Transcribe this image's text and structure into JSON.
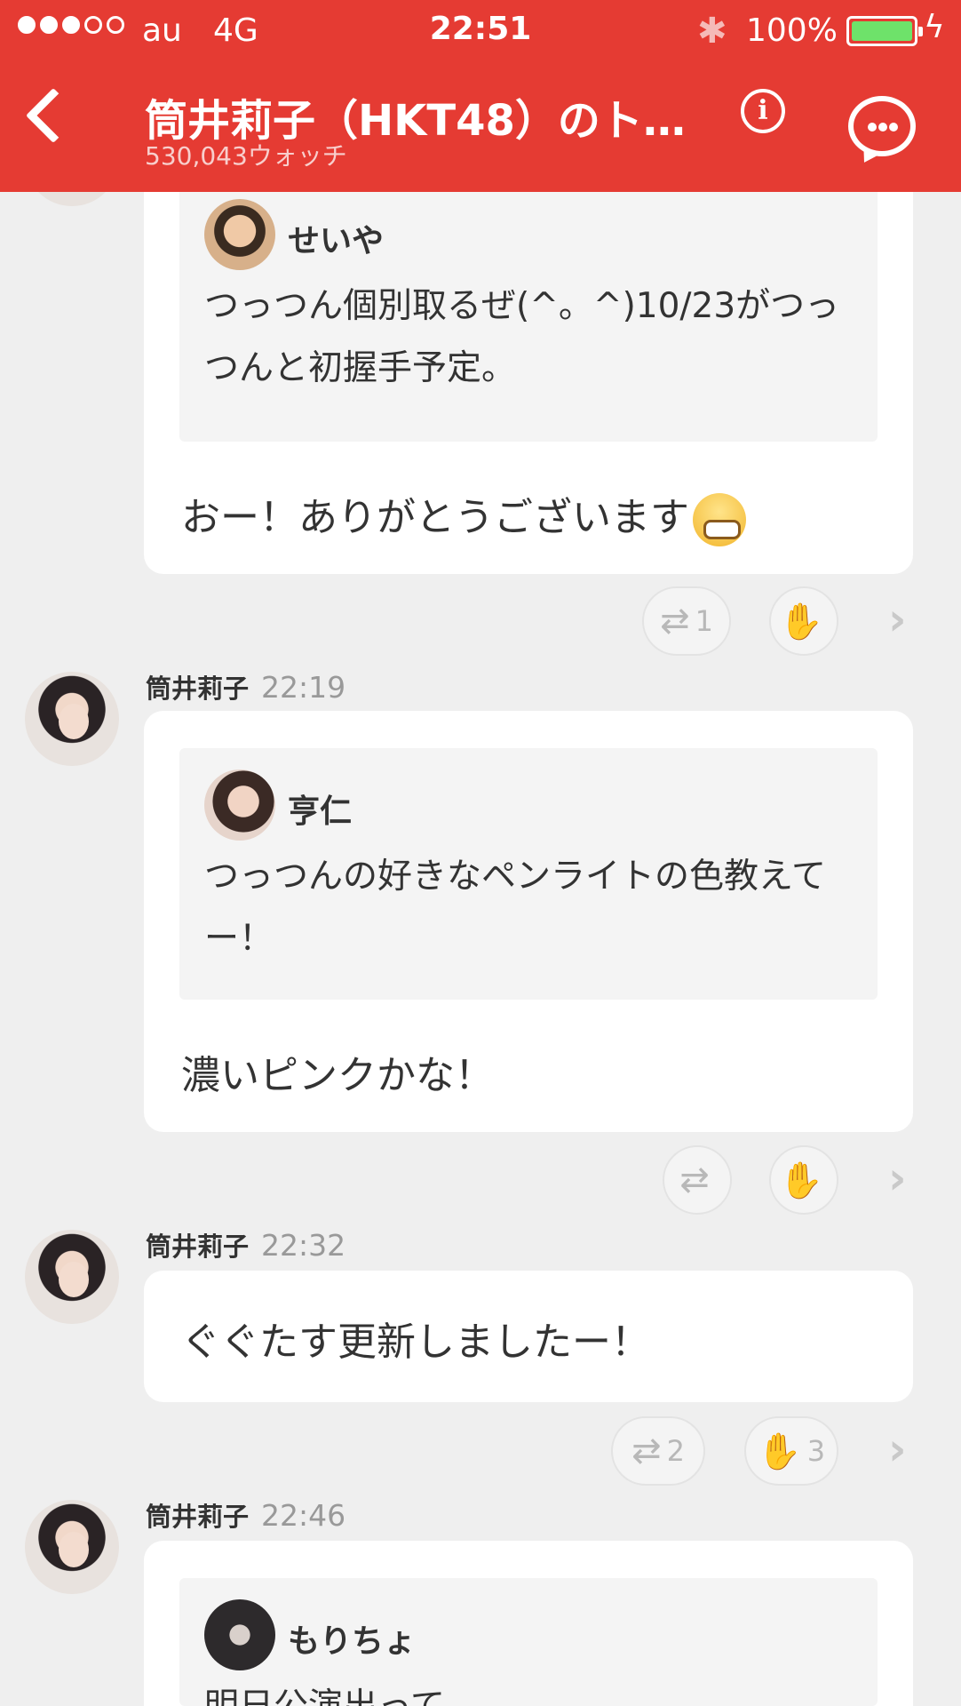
{
  "status_bar": {
    "carrier": "au",
    "network": "4G",
    "time": "22:51",
    "battery_pct": "100%"
  },
  "header": {
    "title": "筒井莉子（HKT48）のト…",
    "watch_count": "530,043ウォッチ"
  },
  "messages": [
    {
      "quote": {
        "name": "せいや",
        "text": "つっつん個別取るぜ(^。^)10/23がつっつんと初握手予定。"
      },
      "reply": "おー！ありがとうございます",
      "retweets": "1",
      "claps": ""
    },
    {
      "author": "筒井莉子",
      "time": "22:19",
      "quote": {
        "name": "亨仁",
        "text": "つっつんの好きなペンライトの色教えてー！"
      },
      "reply": "濃いピンクかな！",
      "retweets": "",
      "claps": ""
    },
    {
      "author": "筒井莉子",
      "time": "22:32",
      "reply": "ぐぐたす更新しましたー！",
      "retweets": "2",
      "claps": "3"
    },
    {
      "author": "筒井莉子",
      "time": "22:46",
      "quote": {
        "name": "もりちょ",
        "text": "明日公演出って"
      }
    }
  ]
}
